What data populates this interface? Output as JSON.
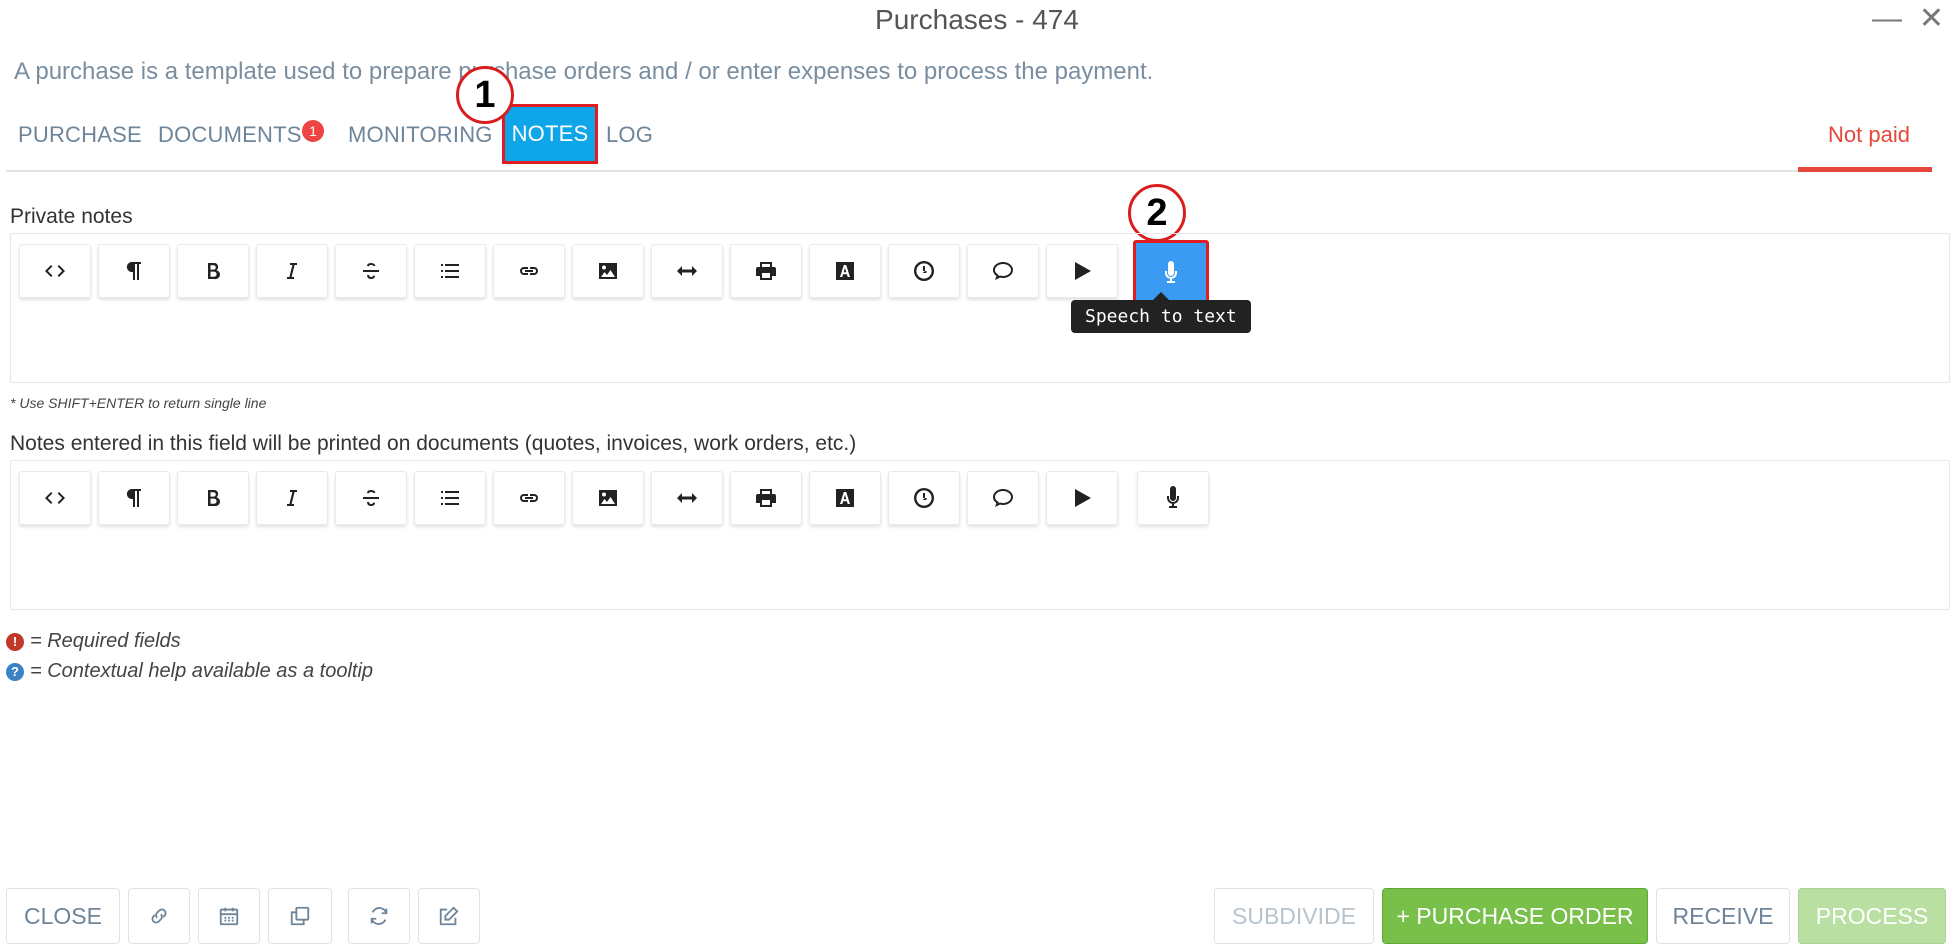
{
  "window": {
    "title": "Purchases - 474",
    "minimize": "—",
    "close": "✕"
  },
  "subtitle": "A purchase is a template used to prepare purchase orders and / or enter expenses to process the payment.",
  "tabs": {
    "purchase": "PURCHASE",
    "documents": "DOCUMENTS",
    "documents_badge": "1",
    "monitoring": "MONITORING",
    "notes": "NOTES",
    "log": "LOG",
    "status": "Not paid"
  },
  "callouts": {
    "one": "1",
    "two": "2"
  },
  "private_notes": {
    "label": "Private notes"
  },
  "printed_notes": {
    "label": "Notes entered in this field will be printed on documents (quotes, invoices, work orders, etc.)"
  },
  "toolbar_buttons": [
    "code",
    "paragraph",
    "bold",
    "italic",
    "strikethrough",
    "list",
    "link",
    "image",
    "horizontal-rule",
    "print",
    "font-color",
    "clock",
    "comment",
    "play",
    "microphone"
  ],
  "tooltip": "Speech to text",
  "hint": "* Use SHIFT+ENTER to return single line",
  "legend": {
    "required_icon": "!",
    "required": "= Required fields",
    "help_icon": "?",
    "help": "= Contextual help available as a tooltip"
  },
  "footer": {
    "close": "CLOSE",
    "subdivide": "SUBDIVIDE",
    "purchase_order": "+ PURCHASE ORDER",
    "receive": "RECEIVE",
    "process": "PROCESS"
  },
  "colors": {
    "active_tab": "#0ea5e9",
    "status_red": "#e5483b",
    "highlight_red": "#e11d22",
    "mic_active": "#3b9af2",
    "green": "#78c04a",
    "green_disabled": "#b9dfa2"
  }
}
